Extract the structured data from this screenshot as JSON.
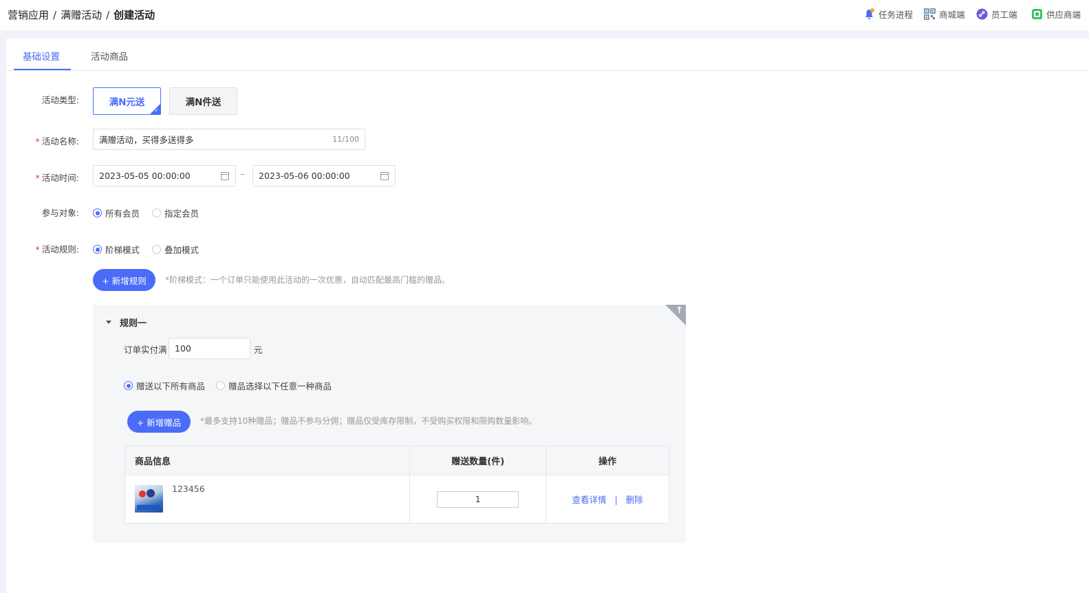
{
  "breadcrumb": [
    "营销应用",
    "满赠活动",
    "创建活动"
  ],
  "header": {
    "tasks": "任务进程",
    "mall": "商城端",
    "staff": "员工端",
    "supplier": "供应商端"
  },
  "tabs": [
    "基础设置",
    "活动商品"
  ],
  "form": {
    "type_label": "活动类型:",
    "type_options": [
      "满N元送",
      "满N件送"
    ],
    "name_label": "活动名称:",
    "name_value": "满赠活动，买得多送得多",
    "name_counter": "11/100",
    "time_label": "活动时间:",
    "time_start": "2023-05-05 00:00:00",
    "time_sep": "–",
    "time_end": "2023-05-06 00:00:00",
    "target_label": "参与对象:",
    "target_options": [
      "所有会员",
      "指定会员"
    ],
    "rule_label": "活动规则:",
    "rule_options": [
      "阶梯模式",
      "叠加模式"
    ],
    "add_rule": "+ 新增规则",
    "rule_hint": "*阶梯模式：一个订单只能使用此活动的一次优惠，自动匹配最高门槛的赠品。"
  },
  "rule": {
    "title": "规则一",
    "threshold_label": "订单实付满",
    "threshold_value": "100",
    "unit": "元",
    "gift_options": [
      "赠送以下所有商品",
      "赠品选择以下任意一种商品"
    ],
    "add_gift": "+ 新增赠品",
    "gift_hint": "*最多支持10种赠品；赠品不参与分佣；赠品仅受库存限制，不受购买权限和限购数量影响。",
    "table": {
      "headers": [
        "商品信息",
        "赠送数量(件)",
        "操作"
      ],
      "rows": [
        {
          "name": "123456",
          "qty": "1",
          "view": "查看详情",
          "sep": "|",
          "delete": "删除"
        }
      ]
    }
  },
  "colors": {
    "primary": "#4a6cf7",
    "required": "#f0313a"
  }
}
